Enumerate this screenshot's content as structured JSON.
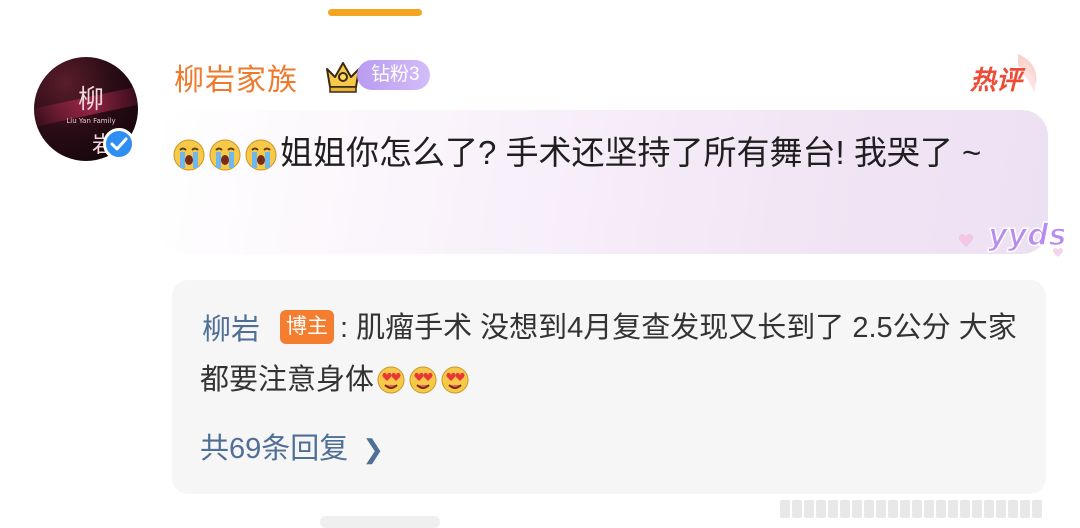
{
  "header": {
    "username": "柳岩家族",
    "fan_level": "钻粉3",
    "hot_label": "热评"
  },
  "avatar": {
    "char_top": "柳",
    "char_bottom": "岩",
    "caption": "Liu Yan Family"
  },
  "comment": {
    "emoji": [
      "cry-face",
      "cry-face",
      "cry-face"
    ],
    "text": "姐姐你怎么了? 手术还坚持了所有舞台! 我哭了 ~",
    "decoration": "yyds"
  },
  "reply": {
    "author": "柳岩",
    "role_badge": "博主",
    "text": ": 肌瘤手术 没想到4月复查发现又长到了 2.5公分 大家都要注意身体",
    "emoji": [
      "heart-face",
      "heart-face",
      "heart-face"
    ],
    "count_label": "共69条回复"
  },
  "colors": {
    "username": "#ef7a2e",
    "link": "#4f6f96",
    "hot": "#ee4c36",
    "badge_purple": "#c6aef5",
    "badge_orange": "#f47d2f",
    "top_indicator": "#f4a623"
  }
}
